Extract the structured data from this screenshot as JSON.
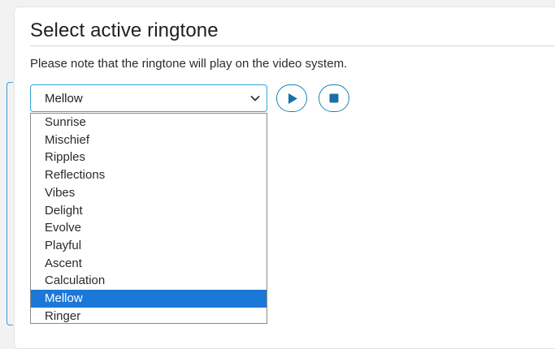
{
  "header": {
    "title": "Select active ringtone"
  },
  "note": "Please note that the ringtone will play on the video system.",
  "ringtone_select": {
    "selected_value": "Mellow"
  },
  "controls": {
    "play_icon": "play-icon",
    "stop_icon": "stop-icon"
  },
  "dropdown": {
    "options": [
      {
        "label": "Sunrise"
      },
      {
        "label": "Mischief"
      },
      {
        "label": "Ripples"
      },
      {
        "label": "Reflections"
      },
      {
        "label": "Vibes"
      },
      {
        "label": "Delight"
      },
      {
        "label": "Evolve"
      },
      {
        "label": "Playful"
      },
      {
        "label": "Ascent"
      },
      {
        "label": "Calculation"
      },
      {
        "label": "Mellow",
        "selected": true
      },
      {
        "label": "Ringer"
      }
    ]
  },
  "colors": {
    "accent": "#31a3d8",
    "button_border": "#1a7fb8",
    "selected_bg": "#1c78d6",
    "selected_text": "#ffffff"
  }
}
